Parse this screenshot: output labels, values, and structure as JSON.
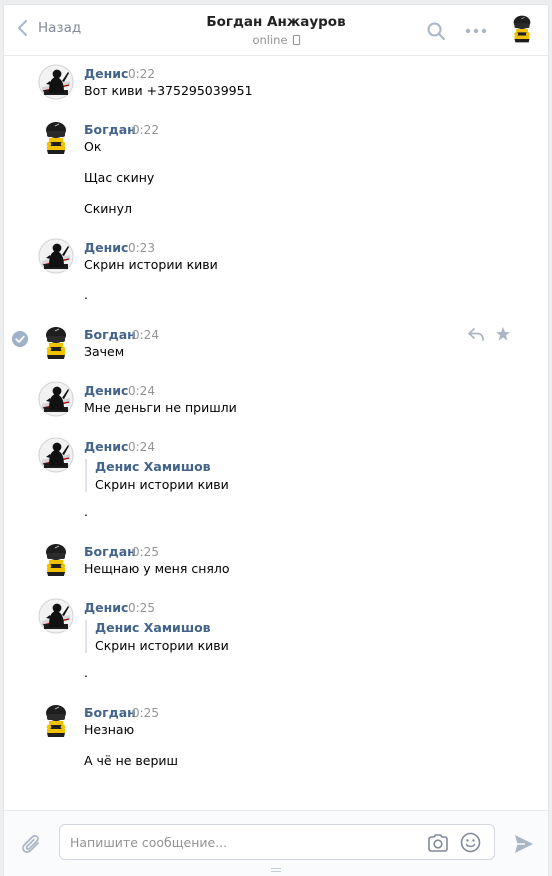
{
  "header": {
    "back_label": "Назад",
    "title": "Богдан Анжауров",
    "status": "online"
  },
  "messages": [
    {
      "author": "Денис",
      "time": "0:22",
      "lines": [
        "Вот киви +375295039951"
      ]
    },
    {
      "author": "Богдан",
      "time": "0:22",
      "lines": [
        "Ок",
        "Щас скину",
        "Скинул"
      ]
    },
    {
      "author": "Денис",
      "time": "0:23",
      "lines": [
        "Скрин истории киви",
        "."
      ]
    },
    {
      "author": "Богдан",
      "time": "0:24",
      "lines": [
        "Зачем"
      ]
    },
    {
      "author": "Денис",
      "time": "0:24",
      "lines": [
        "Мне деньги не пришли"
      ]
    },
    {
      "author": "Денис",
      "time": "0:24",
      "quote": {
        "author": "Денис Хамишов",
        "text": "Скрин истории киви"
      },
      "lines": [
        "."
      ]
    },
    {
      "author": "Богдан",
      "time": "0:25",
      "lines": [
        "Нещнаю у меня сняло"
      ]
    },
    {
      "author": "Денис",
      "time": "0:25",
      "quote": {
        "author": "Денис Хамишов",
        "text": "Скрин истории киви"
      },
      "lines": [
        "."
      ]
    },
    {
      "author": "Богдан",
      "time": "0:25",
      "lines": [
        "Незнаю",
        "А чё не вериш"
      ]
    }
  ],
  "composer": {
    "placeholder": "Напишите сообщение..."
  },
  "icons": {
    "back": "chevron-left-icon",
    "search": "search-icon",
    "more": "more-dots-icon",
    "attach": "paperclip-icon",
    "camera": "camera-icon",
    "emoji": "smile-icon",
    "send": "send-icon",
    "reply": "reply-icon",
    "favorite": "star-icon",
    "selected": "check-circle-icon"
  },
  "colors": {
    "author": "#42648b",
    "time": "#939393",
    "accent": "#5181b8",
    "icon": "#aab6c5"
  }
}
